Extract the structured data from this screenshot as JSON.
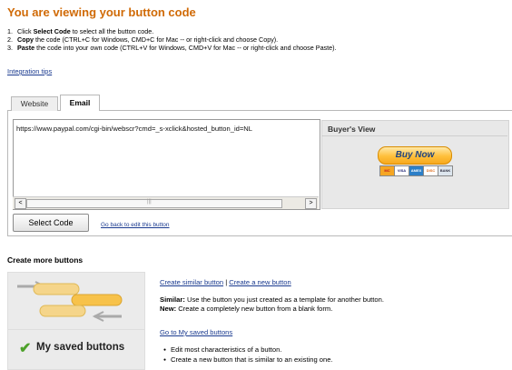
{
  "header": {
    "title": "You are viewing your button code"
  },
  "steps": [
    {
      "num": "1.",
      "lead": "Click ",
      "bold": "Select Code",
      "rest": " to select all the button code."
    },
    {
      "num": "2.",
      "lead": "",
      "bold": "Copy",
      "rest": " the code (CTRL+C for Windows, CMD+C for Mac -- or right-click and choose Copy)."
    },
    {
      "num": "3.",
      "lead": "",
      "bold": "Paste",
      "rest": " the code into your own code (CTRL+V for Windows, CMD+V for Mac -- or right-click and choose Paste)."
    }
  ],
  "links": {
    "integration_tips": "Integration tips",
    "back_to_edit": "Go back to edit this button"
  },
  "tabs": [
    {
      "label": "Website"
    },
    {
      "label": "Email"
    }
  ],
  "code": {
    "text": "https://www.paypal.com/cgi-bin/webscr?cmd=_s-xclick&hosted_button_id=NL"
  },
  "scrollbar": {
    "left_arrow": "<",
    "right_arrow": ">",
    "grip": "|||"
  },
  "buyer_view": {
    "title": "Buyer's View",
    "button_label": "Buy Now",
    "cards": [
      "MC",
      "VISA",
      "AMEX",
      "DISC",
      "BANK"
    ]
  },
  "select_code_label": "Select Code",
  "create_more": {
    "title": "Create more buttons",
    "similar_link": "Create similar button",
    "separator": "|",
    "new_link": "Create a new button",
    "similar_bold": "Similar:",
    "similar_desc": " Use the button you just created as a template for another button.",
    "new_bold": "New:",
    "new_desc": " Create a completely new button from a blank form.",
    "saved_link": "Go to My saved buttons",
    "saved_items": [
      "Edit most characteristics of a button.",
      "Create a new button that is similar to an existing one."
    ],
    "saved_tile_label": "My saved buttons",
    "check_glyph": "✔"
  },
  "colors": {
    "title": "#d06a06",
    "link": "#1a3a8f",
    "buy_now": "#ffbf3a",
    "check": "#4da12a"
  }
}
